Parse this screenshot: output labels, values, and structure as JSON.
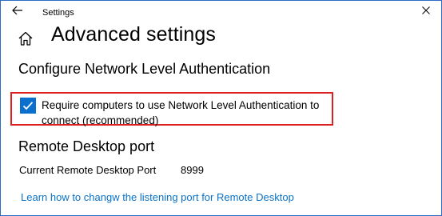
{
  "window": {
    "title": "Settings",
    "back_icon": "arrow-left-icon",
    "close_icon": "close-icon"
  },
  "page": {
    "home_icon": "home-icon",
    "title": "Advanced settings"
  },
  "nla": {
    "heading": "Configure Network Level Authentication",
    "checkbox_label": "Require computers to use Network Level Authentication to connect (recommended)",
    "checked": true
  },
  "rdp_port": {
    "heading": "Remote Desktop port",
    "label": "Current Remote Desktop Port",
    "value": "8999"
  },
  "link": {
    "text": "Learn how to changw the listening port for Remote Desktop"
  },
  "colors": {
    "accent": "#0b6fce",
    "link": "#0b72c6",
    "highlight": "#e02020",
    "frame": "#2b6cc4"
  }
}
